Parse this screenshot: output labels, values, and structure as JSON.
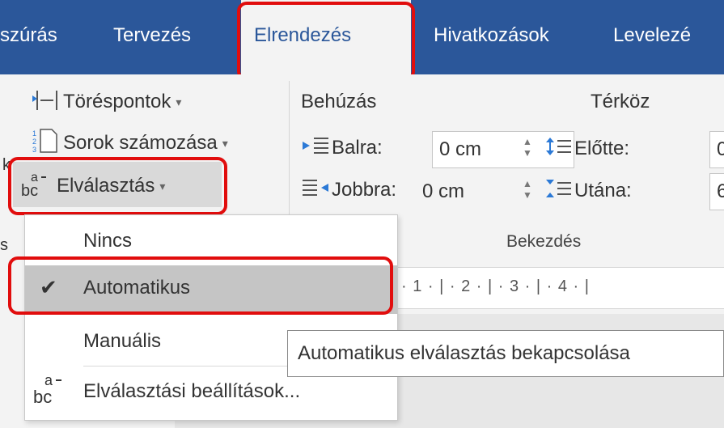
{
  "tabs": {
    "insert_partial": "szúrás",
    "design": "Tervezés",
    "layout": "Elrendezés",
    "references": "Hivatkozások",
    "mailings_partial": "Levelezé"
  },
  "ribbon": {
    "breaks_label": "Töréspontok",
    "line_numbers_label": "Sorok számozása",
    "hyphenation_label": "Elválasztás",
    "indent_heading": "Behúzás",
    "spacing_heading": "Térköz",
    "left_label": "Balra:",
    "left_value": "0 cm",
    "right_label": "Jobbra:",
    "right_value": "0 cm",
    "before_label": "Előtte:",
    "before_value": "0",
    "after_label": "Utána:",
    "after_value": "6",
    "paragraph_group": "Bekezdés",
    "left_edge_s": "s",
    "left_edge_k": "k"
  },
  "ruler": {
    "marks": "· 1 · | · 2 · | · 3 · | · 4 · |"
  },
  "menu": {
    "none": "Nincs",
    "automatic": "Automatikus",
    "manual": "Manuális",
    "options": "Elválasztási beállítások..."
  },
  "tooltip": {
    "text": "Automatikus elválasztás bekapcsolása"
  },
  "colors": {
    "ribbon_blue": "#2b579a",
    "highlight_red": "#e10d0d"
  }
}
